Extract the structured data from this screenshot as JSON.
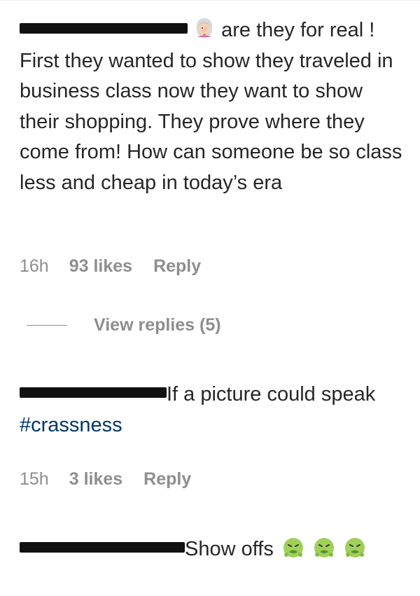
{
  "comments": [
    {
      "text": "are they for real ! First they wanted to show they traveled in business class now they want to show their shopping. They prove where they come from! How can someone be so class less and cheap in today’s era",
      "time": "16h",
      "likes": "93 likes",
      "reply": "Reply",
      "view_replies": "View replies (5)"
    },
    {
      "text": "If a picture could speak ",
      "hashtag": "#crassness",
      "time": "15h",
      "likes": "3 likes",
      "reply": "Reply"
    },
    {
      "text": "Show offs",
      "emoji": "nauseated-face-icon x3"
    }
  ],
  "colors": {
    "text": "#262626",
    "meta": "#8e8e8e",
    "hashtag": "#00376b",
    "redaction": "#111111"
  }
}
